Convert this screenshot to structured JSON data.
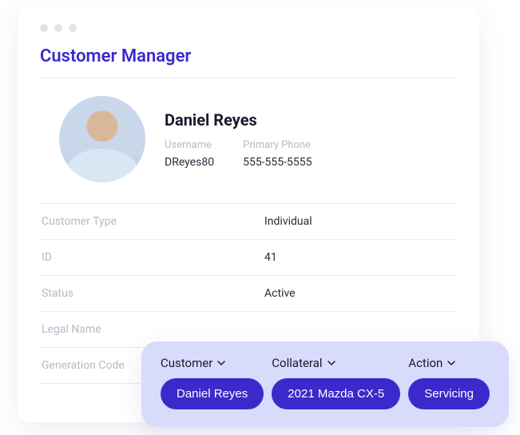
{
  "header": {
    "page_title": "Customer Manager"
  },
  "profile": {
    "name": "Daniel Reyes",
    "username_label": "Username",
    "username_value": "DReyes80",
    "phone_label": "Primary Phone",
    "phone_value": "555-555-5555"
  },
  "details": [
    {
      "label": "Customer Type",
      "value": "Individual"
    },
    {
      "label": "ID",
      "value": "41"
    },
    {
      "label": "Status",
      "value": "Active"
    },
    {
      "label": "Legal Name",
      "value": ""
    },
    {
      "label": "Generation Code",
      "value": ""
    }
  ],
  "action_bar": {
    "groups": [
      {
        "header": "Customer",
        "pill": "Daniel Reyes"
      },
      {
        "header": "Collateral",
        "pill": "2021 Mazda CX-5"
      },
      {
        "header": "Action",
        "pill": "Servicing"
      }
    ]
  }
}
